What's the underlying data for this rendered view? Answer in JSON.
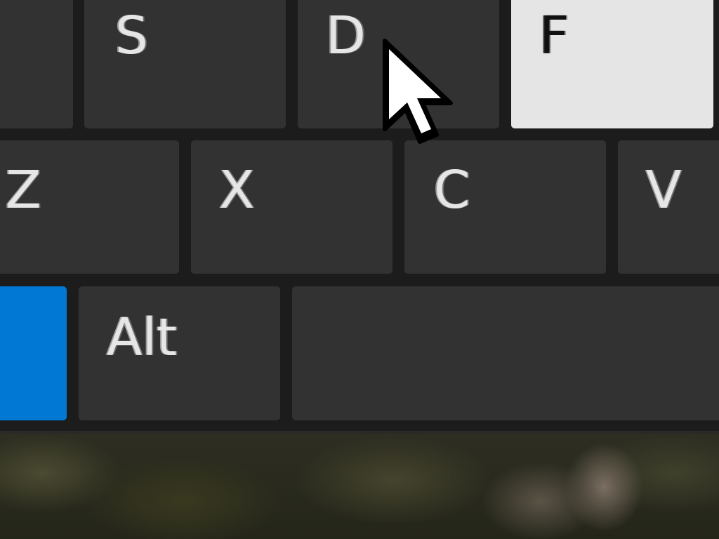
{
  "keyboard": {
    "row1": {
      "a": "",
      "s": "S",
      "d": "D",
      "f": "F"
    },
    "row2": {
      "z": "Z",
      "x": "X",
      "c": "C",
      "v": "V"
    },
    "row3": {
      "win": "",
      "alt": "Alt",
      "space": ""
    }
  },
  "state": {
    "highlighted_key": "F",
    "highlight_color": "#e5e5e5",
    "accent_color": "#0078d4"
  },
  "icons": {
    "cursor": "mouse-pointer-icon"
  }
}
